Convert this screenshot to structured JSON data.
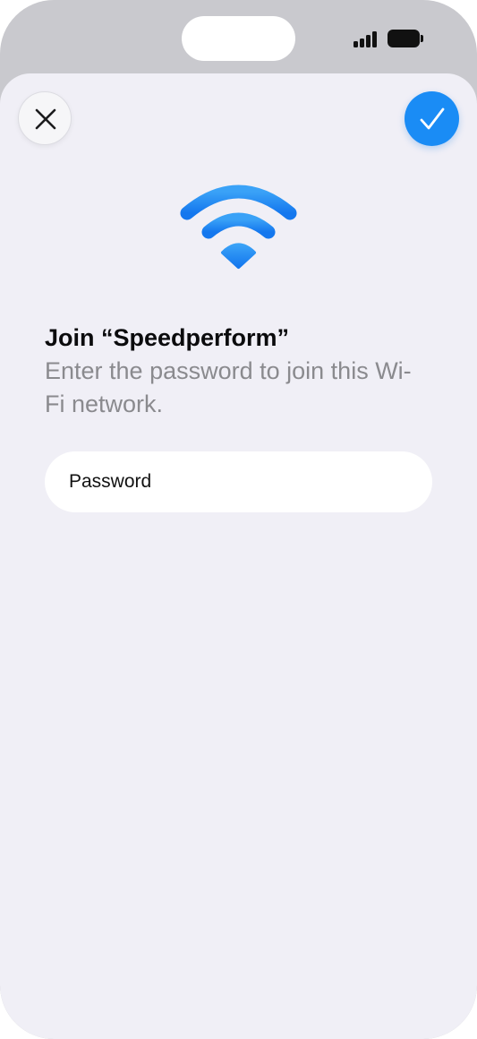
{
  "status_bar": {
    "signal_icon": "cellular-signal-icon",
    "battery_icon": "battery-icon"
  },
  "toolbar": {
    "close_icon": "close-icon",
    "confirm_icon": "checkmark-icon"
  },
  "header": {
    "icon": "wifi-icon",
    "title": "Join “Speedperform”",
    "subtitle": "Enter the password to join this Wi-Fi network."
  },
  "form": {
    "password_placeholder": "Password",
    "password_value": ""
  },
  "colors": {
    "accent": "#1a8cf5",
    "background": "#f0eff6",
    "secondary_text": "#8a8a8e"
  }
}
